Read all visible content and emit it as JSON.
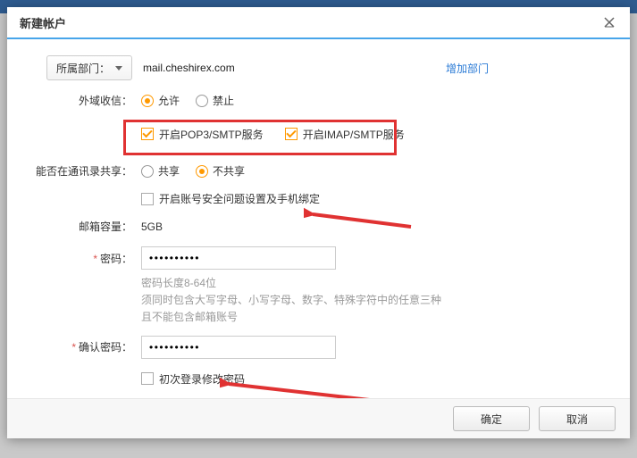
{
  "dialog": {
    "title": "新建帐户",
    "close_label": "关闭"
  },
  "department": {
    "button_label": "所属部门：",
    "domain": "mail.cheshirex.com",
    "add_link": "增加部门"
  },
  "external_receive": {
    "label": "外域收信：",
    "allow": "允许",
    "deny": "禁止",
    "value": "allow"
  },
  "services": {
    "pop3_label": "开启POP3/SMTP服务",
    "imap_label": "开启IMAP/SMTP服务",
    "pop3_checked": true,
    "imap_checked": true
  },
  "contacts_share": {
    "label": "能否在通讯录共享：",
    "share": "共享",
    "noshare": "不共享",
    "value": "noshare"
  },
  "security": {
    "label": "开启账号安全问题设置及手机绑定",
    "checked": false
  },
  "mailbox": {
    "label": "邮箱容量：",
    "value": "5GB"
  },
  "password": {
    "label": "密码：",
    "value": "••••••••••",
    "hint1": "密码长度8-64位",
    "hint2": "须同时包含大写字母、小写字母、数字、特殊字符中的任意三种",
    "hint3": "且不能包含邮箱账号"
  },
  "confirm_password": {
    "label": "确认密码：",
    "value": "••••••••••"
  },
  "first_login": {
    "label": "初次登录修改密码",
    "checked": false
  },
  "footer": {
    "ok": "确定",
    "cancel": "取消"
  },
  "colors": {
    "accent_blue": "#48a5ea",
    "highlight_red": "#e03232",
    "radio_orange": "#ff9900"
  }
}
